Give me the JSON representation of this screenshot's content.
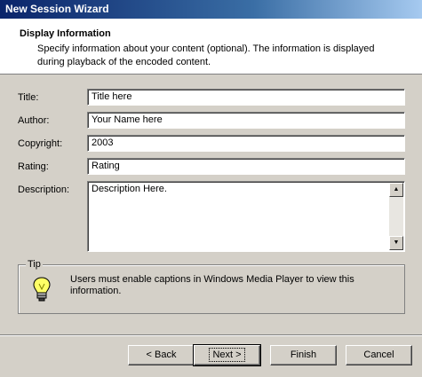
{
  "window": {
    "title": "New Session Wizard"
  },
  "header": {
    "title": "Display Information",
    "description": "Specify information about your content (optional). The information is displayed during playback of the encoded content."
  },
  "form": {
    "title_label": "Title:",
    "title_value": "Title here",
    "author_label": "Author:",
    "author_value": "Your Name here",
    "copyright_label": "Copyright:",
    "copyright_value": "2003",
    "rating_label": "Rating:",
    "rating_value": "Rating",
    "description_label": "Description:",
    "description_value": "Description Here."
  },
  "tip": {
    "legend": "Tip",
    "icon": "lightbulb-icon",
    "text": "Users must enable captions in Windows Media Player to view this information."
  },
  "buttons": {
    "back": "< Back",
    "next": "Next >",
    "finish": "Finish",
    "cancel": "Cancel"
  },
  "colors": {
    "titlebar_start": "#0a246a",
    "titlebar_end": "#a6caf0",
    "face": "#d4d0c8"
  }
}
